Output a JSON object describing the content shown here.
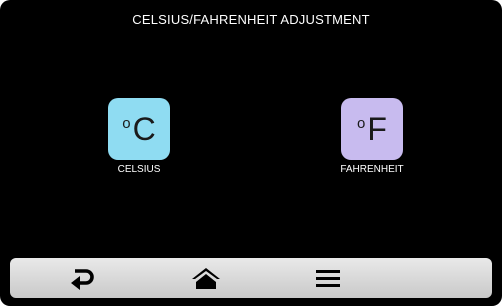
{
  "screen": {
    "title": "CELSIUS/FAHRENHEIT ADJUSTMENT"
  },
  "options": [
    {
      "id": "celsius",
      "degree_symbol": "o",
      "symbol": "C",
      "label": "CELSIUS",
      "color": "#8fdcf2"
    },
    {
      "id": "fahrenheit",
      "degree_symbol": "o",
      "symbol": "F",
      "label": "FAHRENHEIT",
      "color": "#c8bbef"
    }
  ],
  "toolbar": {
    "buttons": [
      {
        "name": "back",
        "icon": "return-arrow-icon"
      },
      {
        "name": "home",
        "icon": "home-icon"
      },
      {
        "name": "menu",
        "icon": "hamburger-menu-icon"
      }
    ]
  }
}
